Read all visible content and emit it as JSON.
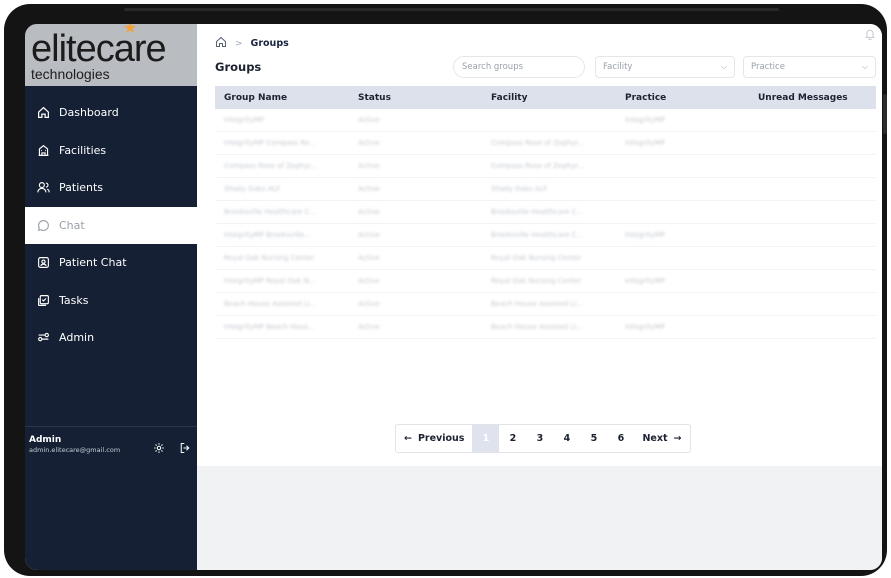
{
  "brand": {
    "logo_main": "elitecare",
    "logo_sub": "technologies",
    "accent": "#f2a236"
  },
  "sidebar": {
    "items": [
      {
        "label": "Dashboard",
        "icon": "home-icon",
        "active": false
      },
      {
        "label": "Facilities",
        "icon": "building-icon",
        "active": false
      },
      {
        "label": "Patients",
        "icon": "users-icon",
        "active": false
      },
      {
        "label": "Chat",
        "icon": "chat-icon",
        "active": true
      },
      {
        "label": "Patient Chat",
        "icon": "patient-chat-icon",
        "active": false
      },
      {
        "label": "Tasks",
        "icon": "tasks-icon",
        "active": false
      },
      {
        "label": "Admin",
        "icon": "admin-icon",
        "active": false
      }
    ],
    "user": {
      "name": "Admin",
      "email": "admin.elitecare@gmail.com"
    }
  },
  "breadcrumb": {
    "current": "Groups"
  },
  "page": {
    "title": "Groups"
  },
  "filters": {
    "search_placeholder": "Search groups",
    "facility_placeholder": "Facility",
    "practice_placeholder": "Practice"
  },
  "table": {
    "headers": [
      "Group Name",
      "Status",
      "Facility",
      "Practice",
      "Unread Messages"
    ],
    "rows": [
      [
        "IntegrityMP",
        "Active",
        "",
        "IntegrityMP",
        ""
      ],
      [
        "IntegrityMP Compass Ro...",
        "Active",
        "Compass Rose of Zephyr...",
        "IntegrityMP",
        ""
      ],
      [
        "Compass Rose of Zephyr...",
        "Active",
        "Compass Rose of Zephyr...",
        "",
        ""
      ],
      [
        "Shady Oaks ALF",
        "Active",
        "Shady Oaks ALF",
        "",
        ""
      ],
      [
        "Brooksville Healthcare C...",
        "Active",
        "Brooksville Healthcare C...",
        "",
        ""
      ],
      [
        "IntegrityMP Brooksville...",
        "Active",
        "Brooksville Healthcare C...",
        "IntegrityMP",
        ""
      ],
      [
        "Royal Oak Nursing Center",
        "Active",
        "Royal Oak Nursing Center",
        "",
        ""
      ],
      [
        "IntegrityMP Royal Oak N...",
        "Active",
        "Royal Oak Nursing Center",
        "IntegrityMP",
        ""
      ],
      [
        "Beach House Assisted Li...",
        "Active",
        "Beach House Assisted Li...",
        "",
        ""
      ],
      [
        "IntegrityMP Beach Hous...",
        "Active",
        "Beach House Assisted Li...",
        "IntegrityMP",
        ""
      ]
    ]
  },
  "pagination": {
    "previous": "Previous",
    "next": "Next",
    "pages": [
      "1",
      "2",
      "3",
      "4",
      "5",
      "6"
    ],
    "current": "1"
  }
}
